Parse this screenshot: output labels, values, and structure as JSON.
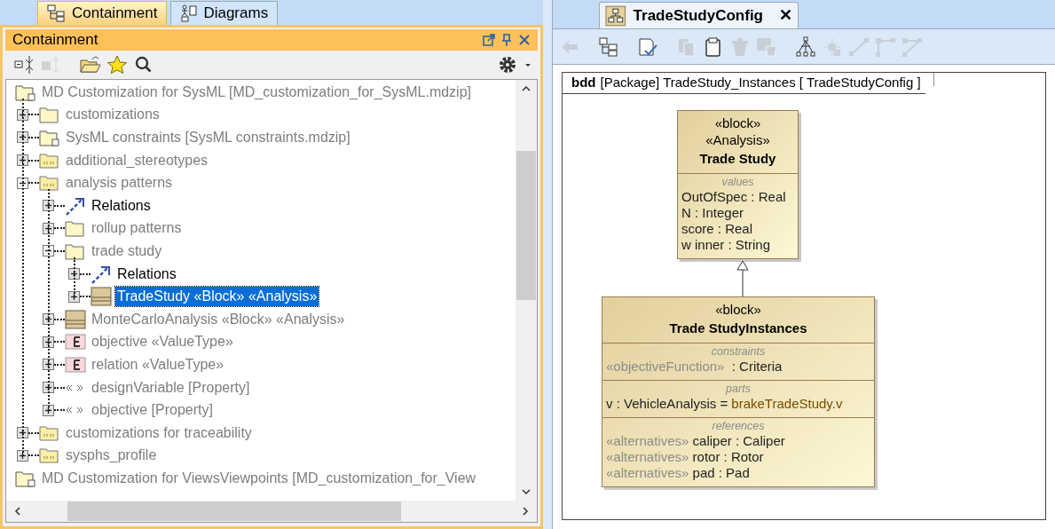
{
  "left_tabs": [
    {
      "label": "Containment",
      "selected": true
    },
    {
      "label": "Diagrams",
      "selected": false
    }
  ],
  "panel": {
    "title": "Containment"
  },
  "tree_toolbar": [
    {
      "kind": "collapse",
      "disabled": false
    },
    {
      "kind": "expand",
      "disabled": true
    },
    {
      "kind": "open",
      "disabled": false
    },
    {
      "kind": "star",
      "disabled": false
    },
    {
      "kind": "search",
      "disabled": false
    }
  ],
  "tree": [
    {
      "label": "MD Customization for SysML [MD_customization_for_SysML.mdzip]",
      "kind": "project",
      "dimmed": true,
      "selected": false,
      "children": [
        {
          "label": "customizations",
          "kind": "folder",
          "dimmed": true,
          "selected": false,
          "expanded": false
        },
        {
          "label": "SysML constraints [SysML constraints.mdzip]",
          "kind": "project",
          "dimmed": true,
          "selected": false,
          "expanded": false
        },
        {
          "label": "additional_stereotypes",
          "kind": "profile",
          "dimmed": true,
          "selected": false,
          "expanded": false
        },
        {
          "label": "analysis patterns",
          "kind": "profile",
          "dimmed": true,
          "selected": false,
          "expanded": true,
          "children": [
            {
              "label": "Relations",
              "kind": "relations",
              "dimmed": false,
              "selected": false,
              "expanded": false
            },
            {
              "label": "rollup patterns",
              "kind": "folder",
              "dimmed": true,
              "selected": false,
              "expanded": false
            },
            {
              "label": "trade study",
              "kind": "folder",
              "dimmed": true,
              "selected": false,
              "expanded": true,
              "children": [
                {
                  "label": "Relations",
                  "kind": "relations",
                  "dimmed": false,
                  "selected": false,
                  "expanded": false
                },
                {
                  "label": "TradeStudy «Block» «Analysis»",
                  "kind": "block",
                  "dimmed": false,
                  "selected": true,
                  "expanded": false
                }
              ]
            },
            {
              "label": "MonteCarloAnalysis «Block» «Analysis»",
              "kind": "block",
              "dimmed": true,
              "selected": false,
              "expanded": false
            },
            {
              "label": "objective «ValueType»",
              "kind": "enum",
              "dimmed": true,
              "selected": false,
              "expanded": false
            },
            {
              "label": "relation «ValueType»",
              "kind": "enum",
              "dimmed": true,
              "selected": false,
              "expanded": false
            },
            {
              "label": "designVariable [Property]",
              "kind": "stereotype",
              "dimmed": true,
              "selected": false,
              "expanded": false
            },
            {
              "label": "objective [Property]",
              "kind": "stereotype",
              "dimmed": true,
              "selected": false,
              "expanded": false
            }
          ]
        },
        {
          "label": "customizations for traceability",
          "kind": "profile",
          "dimmed": true,
          "selected": false,
          "expanded": false
        },
        {
          "label": "sysphs_profile",
          "kind": "profile",
          "dimmed": true,
          "selected": false,
          "expanded": false
        }
      ]
    },
    {
      "label": "MD Customization for ViewsViewpoints [MD_customization_for_View",
      "kind": "project",
      "dimmed": true,
      "selected": false
    }
  ],
  "editor_tab": {
    "label": "TradeStudyConfig",
    "close": "✕"
  },
  "diagram_toolbar": [
    {
      "kind": "back",
      "disabled": true
    },
    {
      "kind": "tree",
      "disabled": false
    },
    {
      "kind": "validate",
      "disabled": false
    },
    {
      "kind": "copy",
      "disabled": true
    },
    {
      "kind": "paste",
      "disabled": false
    },
    {
      "kind": "delete",
      "disabled": true
    },
    {
      "kind": "delete-model",
      "disabled": true
    },
    {
      "kind": "layout",
      "disabled": false
    },
    {
      "kind": "node",
      "disabled": true
    },
    {
      "kind": "line",
      "disabled": true
    },
    {
      "kind": "rectilinear",
      "disabled": true
    },
    {
      "kind": "oblique",
      "disabled": true
    }
  ],
  "frame": {
    "kind": "bdd",
    "element": "[Package]",
    "name": "TradeStudy_Instances [",
    "diagram": "TradeStudyConfig",
    "close": "]"
  },
  "blocks": [
    {
      "stereotypes": [
        "«block»",
        "«Analysis»"
      ],
      "name": "Trade Study",
      "compartments": [
        {
          "title": "values",
          "lines": [
            {
              "text": "OutOfSpec : Real"
            },
            {
              "text": "N : Integer"
            },
            {
              "text": "score : Real"
            },
            {
              "text": "w inner : String"
            }
          ]
        }
      ]
    },
    {
      "stereotypes": [
        "«block»"
      ],
      "name": "Trade StudyInstances",
      "compartments": [
        {
          "title": "constraints",
          "lines": [
            {
              "stereotype": "«objectiveFunction»",
              "text": " : Criteria"
            }
          ]
        },
        {
          "title": "parts",
          "lines": [
            {
              "text": "v : VehicleAnalysis =",
              "default": "brakeTradeStudy.v"
            }
          ]
        },
        {
          "title": "references",
          "lines": [
            {
              "stereotype": "«alternatives»",
              "text": "caliper : Caliper"
            },
            {
              "stereotype": "«alternatives»",
              "text": "rotor : Rotor"
            },
            {
              "stereotype": "«alternatives»",
              "text": "pad : Pad"
            }
          ]
        }
      ]
    }
  ],
  "relations": [
    {
      "kind": "generalization"
    }
  ]
}
